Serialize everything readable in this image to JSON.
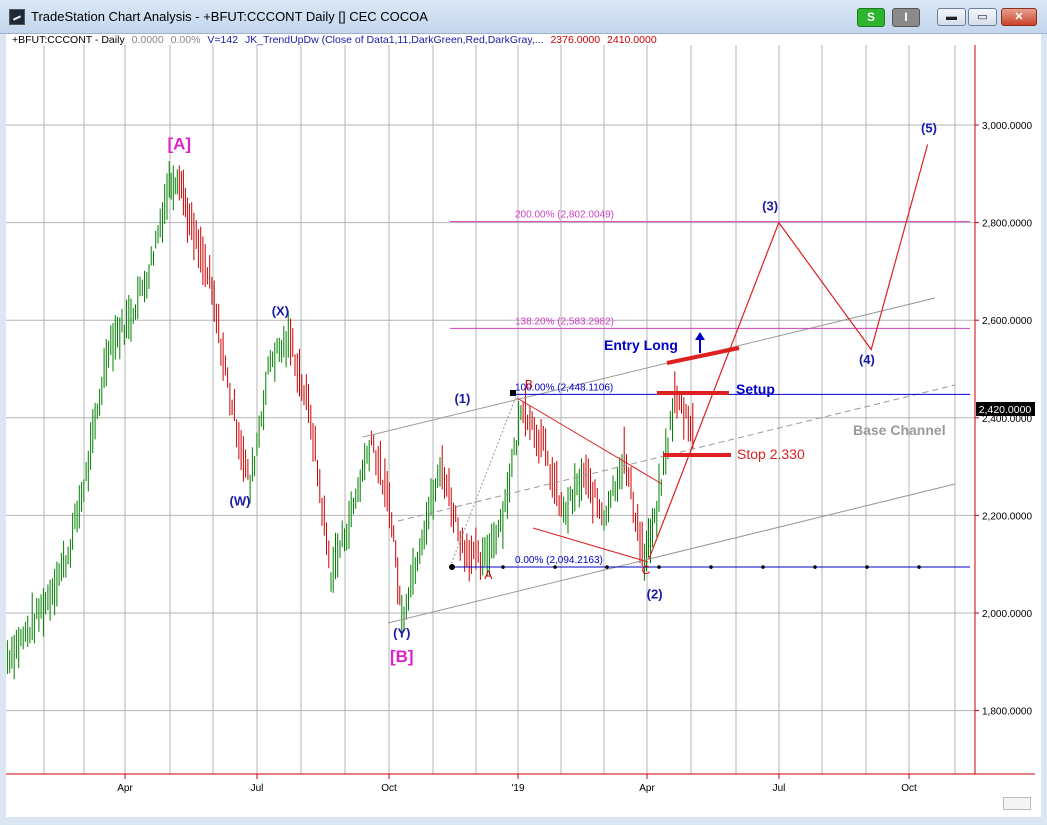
{
  "window": {
    "title": "TradeStation Chart Analysis - +BFUT:CCCONT Daily [] CEC COCOA",
    "btn_s": "S",
    "btn_i": "I",
    "minimize": "▬",
    "maximize": "▭",
    "close": "✕"
  },
  "info": {
    "symbol": "+BFUT:CCCONT - Daily",
    "change": "0.0000",
    "pct": "0.00%",
    "volume": "V=142",
    "indicator": "JK_TrendUpDw (Close of Data1,11,DarkGreen,Red,DarkGray,...",
    "val1": "2376.0000",
    "val2": "2410.0000"
  },
  "colors": {
    "up": "#008000",
    "down": "#cc0000",
    "neutral": "#808080",
    "wave_label": "#1a1aa8",
    "major_label": "#e020c8",
    "fib": "#d040c0",
    "setup": "#0000c8",
    "scenario": "#dd2020"
  },
  "chart_data": {
    "type": "line",
    "xlabel": "",
    "ylabel": "",
    "ylim": [
      1650,
      3100
    ],
    "grid": true,
    "y_ticks": [
      "3,000.0000",
      "2,800.0000",
      "2,600.0000",
      "2,400.0000",
      "2,200.0000",
      "2,000.0000",
      "1,800.0000"
    ],
    "x_ticks": [
      "Apr",
      "Jul",
      "Oct",
      "'19",
      "Apr",
      "Jul",
      "Oct"
    ],
    "last_price": "2,420.0000",
    "series": [
      {
        "x": [
          "2018-01-02",
          "2018-01-16",
          "2018-01-30",
          "2018-02-13",
          "2018-02-27",
          "2018-03-13",
          "2018-03-27",
          "2018-04-10",
          "2018-04-24",
          "2018-05-01",
          "2018-05-08",
          "2018-05-22",
          "2018-06-05",
          "2018-06-19",
          "2018-07-03",
          "2018-07-17",
          "2018-07-31",
          "2018-08-14",
          "2018-08-28",
          "2018-09-11",
          "2018-09-25",
          "2018-10-02",
          "2018-10-16",
          "2018-10-30",
          "2018-11-13",
          "2018-11-27",
          "2018-12-11",
          "2018-12-25",
          "2019-01-08",
          "2019-01-22",
          "2019-02-05",
          "2019-02-19",
          "2019-03-05",
          "2019-03-19",
          "2019-03-26",
          "2019-04-09",
          "2019-04-23"
        ],
        "values": [
          1910,
          1960,
          2030,
          2120,
          2300,
          2550,
          2600,
          2700,
          2880,
          2900,
          2800,
          2680,
          2450,
          2260,
          2520,
          2560,
          2400,
          2080,
          2200,
          2360,
          2200,
          1990,
          2160,
          2300,
          2140,
          2100,
          2200,
          2430,
          2340,
          2200,
          2280,
          2200,
          2320,
          2110,
          2180,
          2440,
          2380
        ]
      }
    ],
    "fib_levels": [
      {
        "label": "200.00% (2,802.0049)",
        "value": 2802.0049
      },
      {
        "label": "138.20% (2,583.2982)",
        "value": 2583.2982
      },
      {
        "label": "100.00% (2,448.1106)",
        "value": 2448.1106
      },
      {
        "label": "0.00% (2,094.2163)",
        "value": 2094.2163
      }
    ],
    "wave_labels": [
      {
        "text": "[A]",
        "x": "2018-05-01",
        "y": 2950
      },
      {
        "text": "(W)",
        "x": "2018-06-12",
        "y": 2220
      },
      {
        "text": "(X)",
        "x": "2018-07-10",
        "y": 2610
      },
      {
        "text": "(Y)",
        "x": "2018-10-02",
        "y": 1950
      },
      {
        "text": "[B]",
        "x": "2018-10-02",
        "y": 1900
      },
      {
        "text": "(1)",
        "x": "2018-11-13",
        "y": 2430
      },
      {
        "text": "A",
        "x": "2018-12-01",
        "y": 2070
      },
      {
        "text": "B",
        "x": "2018-12-29",
        "y": 2460
      },
      {
        "text": "C",
        "x": "2019-03-20",
        "y": 2080
      },
      {
        "text": "(2)",
        "x": "2019-03-26",
        "y": 2030
      },
      {
        "text": "(3)",
        "x": "2019-06-14",
        "y": 2825
      },
      {
        "text": "(4)",
        "x": "2019-08-20",
        "y": 2510
      },
      {
        "text": "(5)",
        "x": "2019-10-02",
        "y": 2985
      }
    ],
    "scenario_path": {
      "x": [
        "2019-03-22",
        "2019-06-20",
        "2019-08-23",
        "2019-10-01"
      ],
      "values": [
        2110,
        2800,
        2540,
        2960
      ]
    },
    "annotations": [
      {
        "text": "Entry Long"
      },
      {
        "text": "Setup"
      },
      {
        "text": "Stop 2.330"
      },
      {
        "text": "Base Channel"
      }
    ]
  }
}
